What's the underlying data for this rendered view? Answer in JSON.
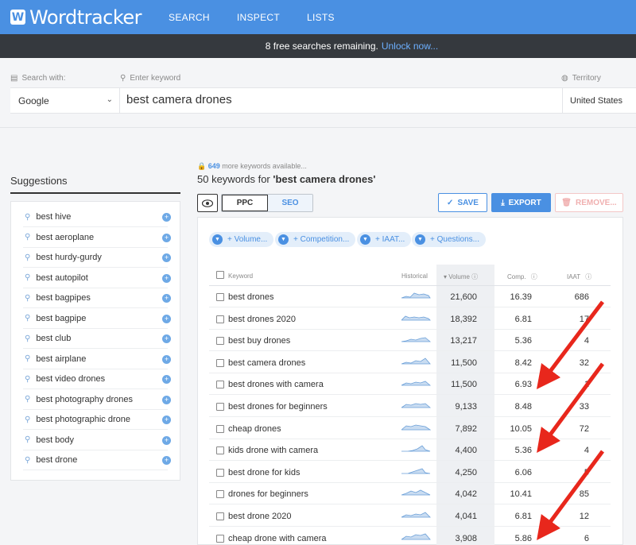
{
  "brand": {
    "logo_letter": "W",
    "name": "Wordtracker"
  },
  "nav": [
    "SEARCH",
    "INSPECT",
    "LISTS"
  ],
  "notice": {
    "text": "8 free searches remaining.",
    "link": "Unlock now..."
  },
  "search": {
    "engine_label": "Search with:",
    "engine_value": "Google",
    "keyword_label": "Enter keyword",
    "keyword_value": "best camera drones",
    "territory_label": "Territory",
    "territory_value": "United States"
  },
  "suggestions": {
    "title": "Suggestions",
    "items": [
      "best hive",
      "best aeroplane",
      "best hurdy-gurdy",
      "best autopilot",
      "best bagpipes",
      "best bagpipe",
      "best club",
      "best airplane",
      "best video drones",
      "best photography drones",
      "best photographic drone",
      "best body",
      "best drone"
    ]
  },
  "results": {
    "more_count": "649",
    "more_text": "more keywords available...",
    "title_prefix": "50 keywords for",
    "title_query": "'best camera drones'",
    "toggle": {
      "ppc": "PPC",
      "seo": "SEO"
    },
    "actions": {
      "save": "SAVE",
      "export": "EXPORT",
      "remove": "REMOVE..."
    },
    "filters": [
      "+ Volume...",
      "+ Competition...",
      "+ IAAT...",
      "+ Questions..."
    ],
    "columns": {
      "keyword": "Keyword",
      "historical": "Historical",
      "volume": "Volume",
      "comp": "Comp.",
      "iaat": "IAAT"
    },
    "rows": [
      {
        "keyword": "best drones",
        "volume": "21,600",
        "comp": "16.39",
        "iaat": "686"
      },
      {
        "keyword": "best drones 2020",
        "volume": "18,392",
        "comp": "6.81",
        "iaat": "17"
      },
      {
        "keyword": "best buy drones",
        "volume": "13,217",
        "comp": "5.36",
        "iaat": "4"
      },
      {
        "keyword": "best camera drones",
        "volume": "11,500",
        "comp": "8.42",
        "iaat": "32"
      },
      {
        "keyword": "best drones with camera",
        "volume": "11,500",
        "comp": "6.93",
        "iaat": "1"
      },
      {
        "keyword": "best drones for beginners",
        "volume": "9,133",
        "comp": "8.48",
        "iaat": "33"
      },
      {
        "keyword": "cheap drones",
        "volume": "7,892",
        "comp": "10.05",
        "iaat": "72"
      },
      {
        "keyword": "kids drone with camera",
        "volume": "4,400",
        "comp": "5.36",
        "iaat": "4"
      },
      {
        "keyword": "best drone for kids",
        "volume": "4,250",
        "comp": "6.06",
        "iaat": "5"
      },
      {
        "keyword": "drones for beginners",
        "volume": "4,042",
        "comp": "10.41",
        "iaat": "85"
      },
      {
        "keyword": "best drone 2020",
        "volume": "4,041",
        "comp": "6.81",
        "iaat": "12"
      },
      {
        "keyword": "cheap drone with camera",
        "volume": "3,908",
        "comp": "5.86",
        "iaat": "6"
      }
    ]
  },
  "colors": {
    "accent": "#4a90e2",
    "arrow": "#e8271c",
    "dark_bar": "#35393e"
  }
}
